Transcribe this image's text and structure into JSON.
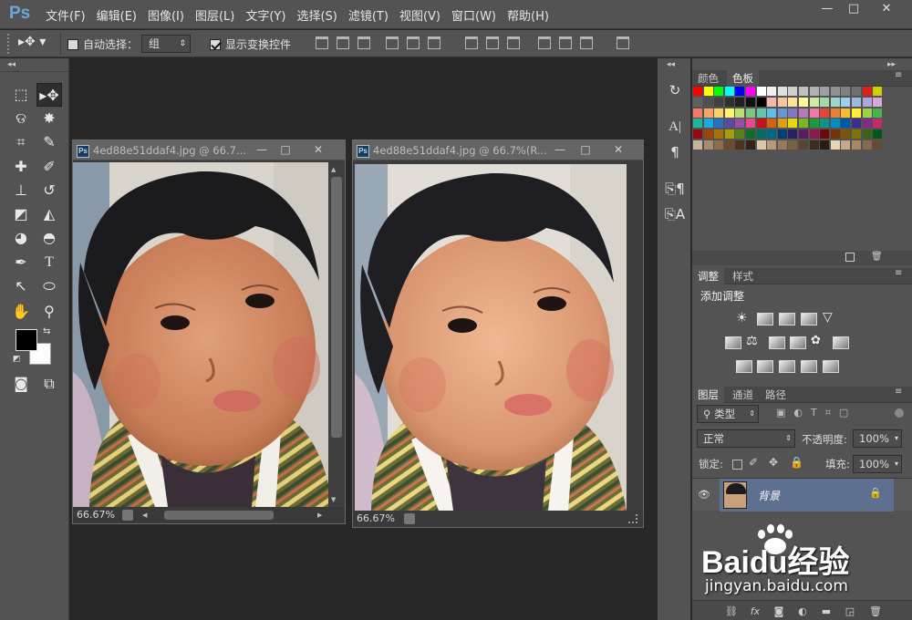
{
  "app": {
    "logo": "Ps"
  },
  "menu": [
    "文件(F)",
    "编辑(E)",
    "图像(I)",
    "图层(L)",
    "文字(Y)",
    "选择(S)",
    "滤镜(T)",
    "视图(V)",
    "窗口(W)",
    "帮助(H)"
  ],
  "window_controls": {
    "minimize": "—",
    "maximize": "□",
    "close": "✕"
  },
  "options": {
    "auto_select_label": "自动选择：",
    "auto_select_value": "组",
    "show_transform_label": "显示变换控件",
    "auto_select_checked": false,
    "show_transform_checked": true
  },
  "documents": [
    {
      "title": "4ed88e51ddaf4.jpg @ 66.7...",
      "zoom": "66.67%"
    },
    {
      "title": "4ed88e51ddaf4.jpg @ 66.7%(R...",
      "zoom": "66.67%"
    }
  ],
  "panels": {
    "color_tabs": [
      "颜色",
      "色板"
    ],
    "adjust_tabs": [
      "调整",
      "样式"
    ],
    "adjust_title": "添加调整",
    "layer_tabs": [
      "图层",
      "通道",
      "路径"
    ],
    "layer_filter": "类型",
    "blend_mode": "正常",
    "opacity_label": "不透明度:",
    "opacity_value": "100%",
    "lock_label": "锁定:",
    "fill_label": "填充:",
    "fill_value": "100%",
    "layer_name": "背景"
  },
  "watermark": {
    "brand": "Baidu经验",
    "url": "jingyan.baidu.com"
  },
  "colors": {
    "accent": "#6ea6da",
    "panel": "#535353",
    "workspace": "#282828"
  }
}
